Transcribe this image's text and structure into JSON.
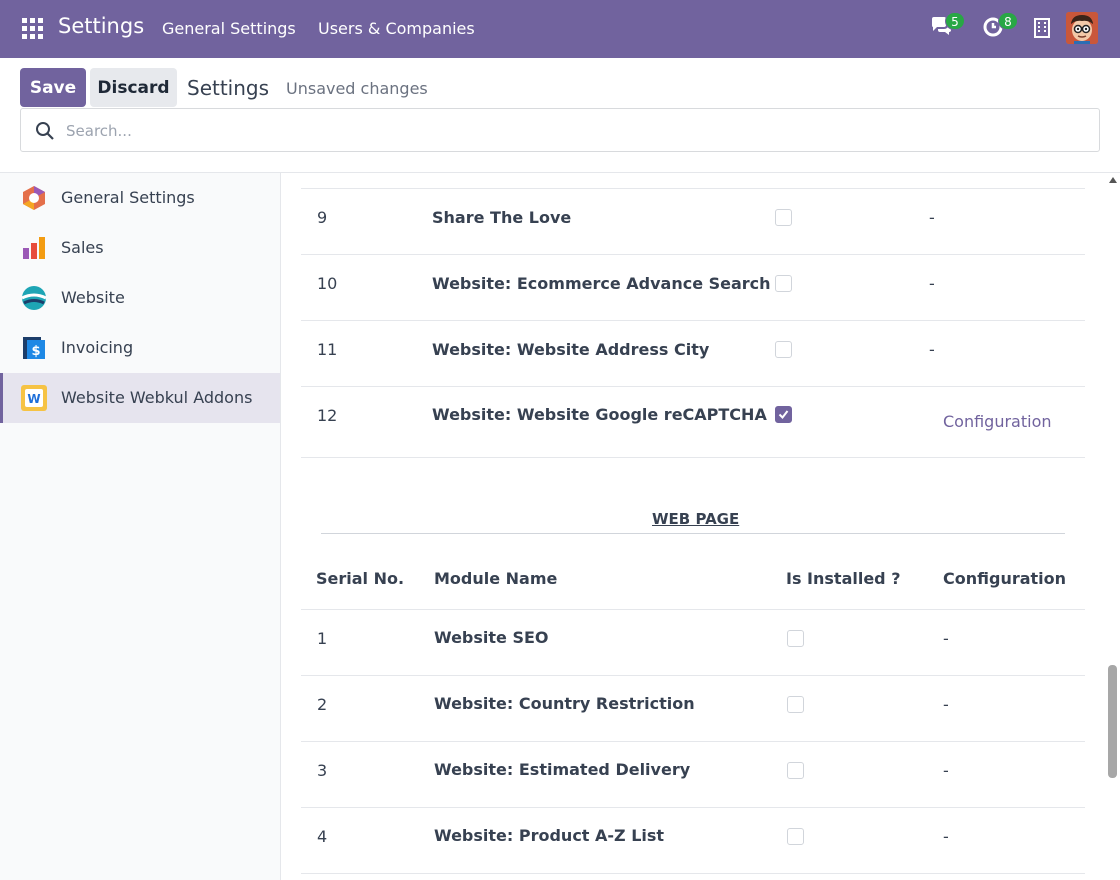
{
  "navbar": {
    "brand": "Settings",
    "menu": [
      "General Settings",
      "Users & Companies"
    ],
    "messages_count": "5",
    "activities_count": "8"
  },
  "control_panel": {
    "save_label": "Save",
    "discard_label": "Discard",
    "title": "Settings",
    "status": "Unsaved changes"
  },
  "search": {
    "placeholder": "Search..."
  },
  "sidebar": {
    "items": [
      {
        "label": "General Settings",
        "icon": "odoo-icon"
      },
      {
        "label": "Sales",
        "icon": "sales-chart-icon"
      },
      {
        "label": "Website",
        "icon": "website-icon"
      },
      {
        "label": "Invoicing",
        "icon": "invoicing-icon"
      },
      {
        "label": "Website Webkul Addons",
        "icon": "webkul-addons-icon",
        "active": true
      }
    ]
  },
  "upper_table": {
    "rows": [
      {
        "serial": "9",
        "name": "Share The Love",
        "installed": false,
        "config": "-"
      },
      {
        "serial": "10",
        "name": "Website: Ecommerce Advance Search",
        "installed": false,
        "config": "-"
      },
      {
        "serial": "11",
        "name": "Website: Website Address City",
        "installed": false,
        "config": "-"
      },
      {
        "serial": "12",
        "name": "Website: Website Google reCAPTCHA",
        "installed": true,
        "config": "Configuration"
      }
    ]
  },
  "web_page_section": {
    "title": "WEB PAGE",
    "headers": {
      "serial": "Serial No.",
      "name": "Module Name",
      "installed": "Is Installed ?",
      "config": "Configuration"
    },
    "rows": [
      {
        "serial": "1",
        "name": "Website SEO",
        "installed": false,
        "config": "-"
      },
      {
        "serial": "2",
        "name": "Website: Country Restriction",
        "installed": false,
        "config": "-"
      },
      {
        "serial": "3",
        "name": "Website: Estimated Delivery",
        "installed": false,
        "config": "-"
      },
      {
        "serial": "4",
        "name": "Website: Product A-Z List",
        "installed": false,
        "config": "-"
      }
    ]
  },
  "colors": {
    "brand": "#71639e",
    "badge": "#28a745"
  }
}
